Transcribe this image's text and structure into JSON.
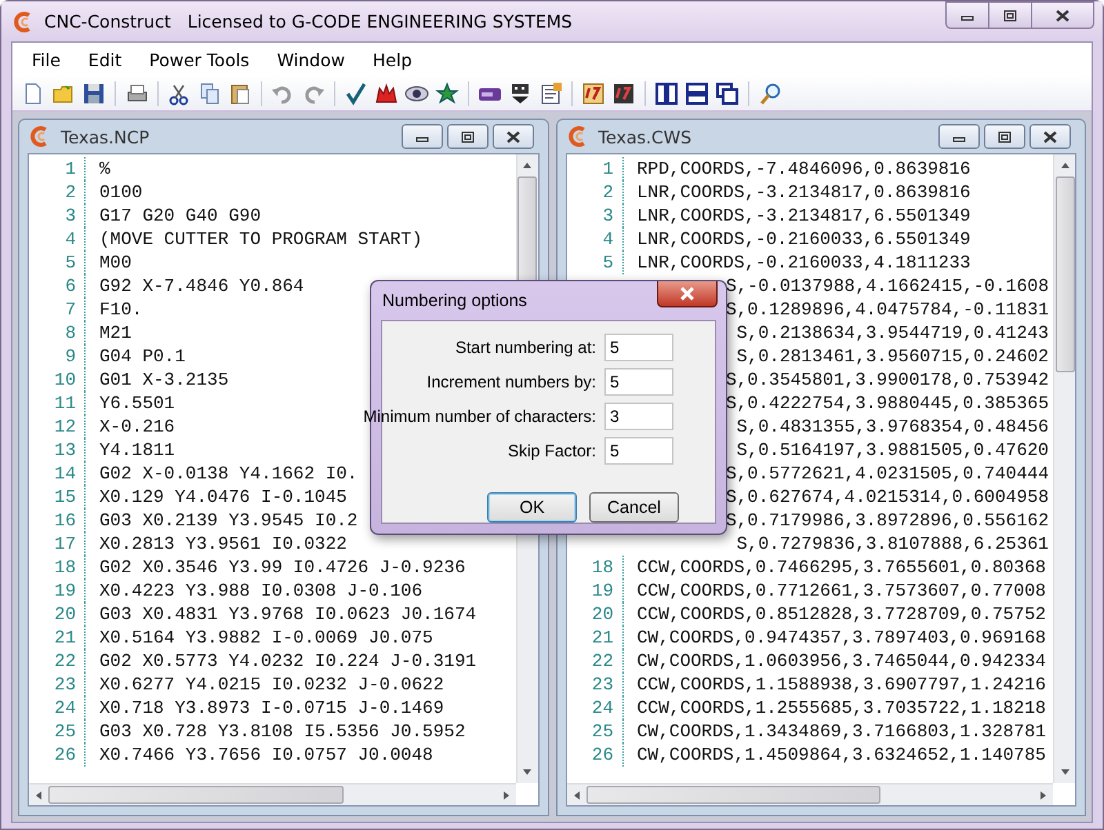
{
  "window": {
    "title": "CNC-Construct",
    "license": "Licensed to G-CODE ENGINEERING SYSTEMS"
  },
  "menu": [
    "File",
    "Edit",
    "Power Tools",
    "Window",
    "Help"
  ],
  "editors": [
    {
      "title": "Texas.NCP",
      "lines": [
        {
          "number": "1",
          "text": "%"
        },
        {
          "number": "2",
          "text": "0100"
        },
        {
          "number": "3",
          "text": "G17 G20 G40 G90"
        },
        {
          "number": "4",
          "text": "(MOVE CUTTER TO PROGRAM START)"
        },
        {
          "number": "5",
          "text": "M00"
        },
        {
          "number": "6",
          "text": "G92 X-7.4846 Y0.864"
        },
        {
          "number": "7",
          "text": "F10."
        },
        {
          "number": "8",
          "text": "M21"
        },
        {
          "number": "9",
          "text": "G04 P0.1"
        },
        {
          "number": "10",
          "text": "G01 X-3.2135"
        },
        {
          "number": "11",
          "text": "Y6.5501"
        },
        {
          "number": "12",
          "text": "X-0.216"
        },
        {
          "number": "13",
          "text": "Y4.1811"
        },
        {
          "number": "14",
          "text": "G02 X-0.0138 Y4.1662 I0."
        },
        {
          "number": "15",
          "text": "X0.129 Y4.0476 I-0.1045"
        },
        {
          "number": "16",
          "text": "G03 X0.2139 Y3.9545 I0.2"
        },
        {
          "number": "17",
          "text": "X0.2813 Y3.9561 I0.0322"
        },
        {
          "number": "18",
          "text": "G02 X0.3546 Y3.99 I0.4726 J-0.9236"
        },
        {
          "number": "19",
          "text": "X0.4223 Y3.988 I0.0308 J-0.106"
        },
        {
          "number": "20",
          "text": "G03 X0.4831 Y3.9768 I0.0623 J0.1674"
        },
        {
          "number": "21",
          "text": "X0.5164 Y3.9882 I-0.0069 J0.075"
        },
        {
          "number": "22",
          "text": "G02 X0.5773 Y4.0232 I0.224 J-0.3191"
        },
        {
          "number": "23",
          "text": "X0.6277 Y4.0215 I0.0232 J-0.0622"
        },
        {
          "number": "24",
          "text": "X0.718 Y3.8973 I-0.0715 J-0.1469"
        },
        {
          "number": "25",
          "text": "G03 X0.728 Y3.8108 I5.5356 J0.5952"
        },
        {
          "number": "26",
          "text": "X0.7466 Y3.7656 I0.0757 J0.0048"
        }
      ]
    },
    {
      "title": "Texas.CWS",
      "lines": [
        {
          "number": "1",
          "text": "RPD,COORDS,-7.4846096,0.8639816"
        },
        {
          "number": "2",
          "text": "LNR,COORDS,-3.2134817,0.8639816"
        },
        {
          "number": "3",
          "text": "LNR,COORDS,-3.2134817,6.5501349"
        },
        {
          "number": "4",
          "text": "LNR,COORDS,-0.2160033,6.5501349"
        },
        {
          "number": "5",
          "text": "LNR,COORDS,-0.2160033,4.1811233"
        },
        {
          "text": "S,-0.0137988,4.1662415,-0.1608",
          "clipped_start": true
        },
        {
          "text": "S,0.1289896,4.0475784,-0.11831",
          "clipped_start": true
        },
        {
          "text": "S,0.2138634,3.9544719,0.41243",
          "clipped_start": true
        },
        {
          "text": "S,0.2813461,3.9560715,0.24602",
          "clipped_start": true
        },
        {
          "text": "S,0.3545801,3.9900178,0.753942",
          "clipped_start": true
        },
        {
          "text": "S,0.4222754,3.9880445,0.385365",
          "clipped_start": true
        },
        {
          "text": "S,0.4831355,3.9768354,0.48456",
          "clipped_start": true
        },
        {
          "text": "S,0.5164197,3.9881505,0.47620",
          "clipped_start": true
        },
        {
          "text": "S,0.5772621,4.0231505,0.740444",
          "clipped_start": true
        },
        {
          "text": "S,0.627674,4.0215314,0.6004958",
          "clipped_start": true
        },
        {
          "text": "S,0.7179986,3.8972896,0.556162",
          "clipped_start": true
        },
        {
          "text": "S,0.7279836,3.8107888,6.25361",
          "clipped_start": true
        },
        {
          "number": "18",
          "text": "CCW,COORDS,0.7466295,3.7655601,0.80368"
        },
        {
          "number": "19",
          "text": "CCW,COORDS,0.7712661,3.7573607,0.77008"
        },
        {
          "number": "20",
          "text": "CCW,COORDS,0.8512828,3.7728709,0.75752"
        },
        {
          "number": "21",
          "text": "CW,COORDS,0.9474357,3.7897403,0.969168"
        },
        {
          "number": "22",
          "text": "CW,COORDS,1.0603956,3.7465044,0.942334"
        },
        {
          "number": "23",
          "text": "CCW,COORDS,1.1588938,3.6907797,1.24216"
        },
        {
          "number": "24",
          "text": "CCW,COORDS,1.2555685,3.7035722,1.18218"
        },
        {
          "number": "25",
          "text": "CW,COORDS,1.3434869,3.7166803,1.328781"
        },
        {
          "number": "26",
          "text": "CW,COORDS,1.4509864,3.6324652,1.140785"
        }
      ]
    }
  ],
  "dialog": {
    "title": "Numbering options",
    "fields": [
      {
        "label": "Start numbering at:",
        "value": "5"
      },
      {
        "label": "Increment numbers by:",
        "value": "5"
      },
      {
        "label": "Minimum number of characters:",
        "value": "3"
      },
      {
        "label": "Skip Factor:",
        "value": "5"
      }
    ],
    "buttons": [
      {
        "label": "OK",
        "default": true
      },
      {
        "label": "Cancel",
        "default": false
      }
    ]
  }
}
